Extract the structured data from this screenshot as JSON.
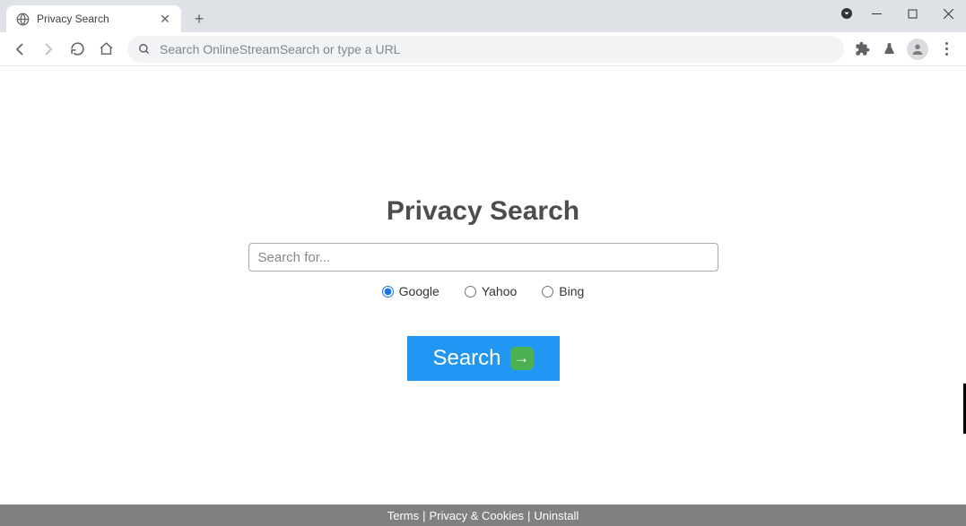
{
  "browser": {
    "tab_title": "Privacy Search",
    "omnibox_placeholder": "Search OnlineStreamSearch or type a URL"
  },
  "page": {
    "title": "Privacy Search",
    "search_placeholder": "Search for...",
    "engines": [
      {
        "label": "Google",
        "selected": true
      },
      {
        "label": "Yahoo",
        "selected": false
      },
      {
        "label": "Bing",
        "selected": false
      }
    ],
    "search_button": "Search"
  },
  "footer": {
    "terms": "Terms",
    "privacy": "Privacy & Cookies",
    "uninstall": "Uninstall"
  }
}
